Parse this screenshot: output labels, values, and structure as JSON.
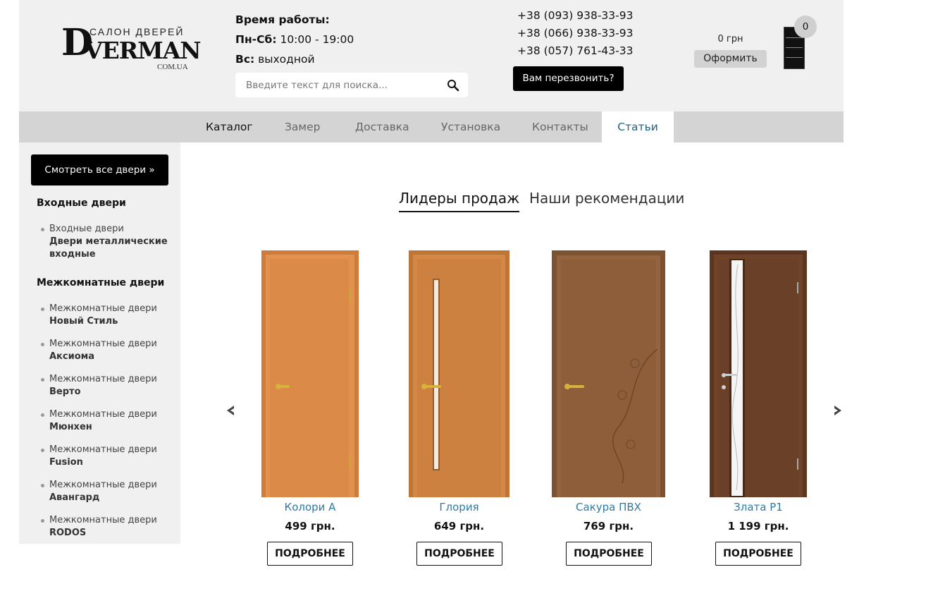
{
  "logo": {
    "letter": "D",
    "name": "VERMAN",
    "tagline": "САЛОН ДВЕРЕЙ",
    "domain": "COM.UA"
  },
  "hours": {
    "title": "Время работы:",
    "weekdays_label": "Пн-Сб:",
    "weekdays_value": "10:00 - 19:00",
    "sunday_label": "Вс:",
    "sunday_value": "выходной"
  },
  "search": {
    "placeholder": "Введите текст для поиска...",
    "icon": "search-icon"
  },
  "phones": [
    "+38 (093) 938-33-93",
    "+38 (066) 938-33-93",
    "+38 (057) 761-43-33"
  ],
  "callback_label": "Вам перезвонить?",
  "cart": {
    "sum": "0 грн",
    "checkout_label": "Оформить",
    "count": "0",
    "icon": "door-cart-icon"
  },
  "nav": {
    "items": [
      "Каталог",
      "Замер",
      "Доставка",
      "Установка",
      "Контакты",
      "Статьи"
    ],
    "active": "Статьи"
  },
  "sidebar": {
    "all_doors_label": "Смотреть все двери »",
    "entrance_title": "Входные двери",
    "entrance_items": [
      {
        "prefix": "Входные двери",
        "name": "Двери металлические входные"
      }
    ],
    "interior_title": "Межкомнатные двери",
    "interior_items": [
      {
        "prefix": "Межкомнатные двери",
        "name": "Новый Стиль"
      },
      {
        "prefix": "Межкомнатные двери",
        "name": "Аксиома"
      },
      {
        "prefix": "Межкомнатные двери",
        "name": "Верто"
      },
      {
        "prefix": "Межкомнатные двери",
        "name": "Мюнхен"
      },
      {
        "prefix": "Межкомнатные двери",
        "name": "Fusion"
      },
      {
        "prefix": "Межкомнатные двери",
        "name": "Авангард"
      },
      {
        "prefix": "Межкомнатные двери",
        "name": "RODOS"
      }
    ]
  },
  "tabs": {
    "items": [
      "Лидеры продаж",
      "Наши рекомендации"
    ],
    "active": "Лидеры продаж"
  },
  "carousel": {
    "prev_icon": "chevron-left-icon",
    "next_icon": "chevron-right-icon"
  },
  "products": [
    {
      "name": "Колори А",
      "price": "499 грн.",
      "button": "ПОДРОБНЕЕ",
      "color": "#d98a45"
    },
    {
      "name": "Глория",
      "price": "649 грн.",
      "button": "ПОДРОБНЕЕ",
      "color": "#c9803f"
    },
    {
      "name": "Сакура ПВХ",
      "price": "769 грн.",
      "button": "ПОДРОБНЕЕ",
      "color": "#8e5e3a"
    },
    {
      "name": "Злата Р1",
      "price": "1 199 грн.",
      "button": "ПОДРОБНЕЕ",
      "color": "#6b4028"
    }
  ]
}
